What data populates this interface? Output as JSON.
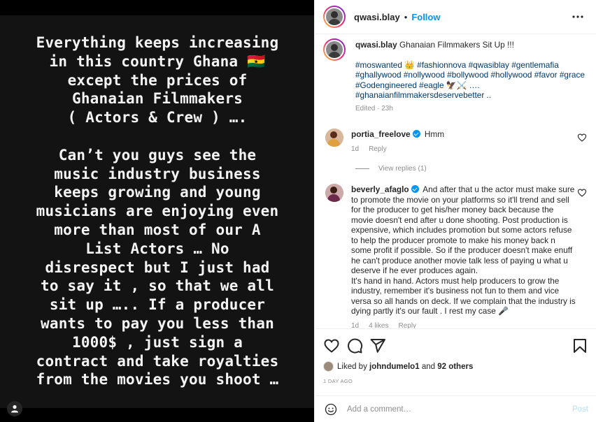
{
  "media": {
    "story_paragraphs": [
      "Everything keeps increasing\nin this country Ghana 🇬🇭\nexcept the prices of\nGhanaian Filmmakers\n( Actors & Crew ) ….",
      "Can’t you guys see the\nmusic industry business\nkeeps growing and young\nmusicians are enjoying even\nmore than most of our A\nList Actors …  No\ndisrespect but I just had\nto say it , so that we all\nsit up ….. If a producer\nwants to pay you less than\n1000$ , just sign a\ncontract and take royalties\nfrom the movies you shoot …"
    ],
    "tag_icon": "user-icon"
  },
  "header": {
    "username": "qwasi.blay",
    "separator": "•",
    "follow_label": "Follow",
    "more_icon": "more-horizontal-icon"
  },
  "caption": {
    "username": "qwasi.blay",
    "text": "Ghanaian Filmmakers Sit Up !!!",
    "hashtags": "#moswanted 👑 #fashionnova #qwasiblay #gentlemafia #ghallywood #nollywood #bollywood #hollywood #favor #grace #Godengineered #eagle 🦅⚔️ …. #ghanaianfilmmakersdeservebetter ..",
    "edited": "Edited · 23h"
  },
  "comments": [
    {
      "username": "portia_freelove",
      "verified": true,
      "text": "Hmm",
      "time": "1d",
      "reply_label": "Reply",
      "view_replies": "View replies (1)"
    },
    {
      "username": "beverly_afaglo",
      "verified": true,
      "text": "And after that u the actor must make sure to promote the movie on your platforms so it'll trend and sell for the producer to get his/her money back because the movie doesn't end after u done shooting. Post production is expensive, which includes promotion but some actors refuse to help the producer promote to make his money back n some profit if possible. So if the producer doesn't make enuff he can't produce another movie talk less of paying u what u deserve if he ever produces again.",
      "text2": "It's hand in hand. Actors must help producers to grow the industry, remember it's business not fun to them and vice versa so all hands on deck. If we complain that the industry is dying partly it's our fault . I rest my case 🎤",
      "time": "1d",
      "likes": "4 likes",
      "reply_label": "Reply"
    }
  ],
  "actions": {
    "like_icon": "heart-icon",
    "comment_icon": "comment-icon",
    "share_icon": "share-icon",
    "save_icon": "bookmark-icon",
    "liked_by_prefix": "Liked by",
    "liked_by_user": "johndumelo1",
    "liked_by_and": "and",
    "liked_by_others": "92 others",
    "date": "1 DAY AGO"
  },
  "add_comment": {
    "emoji_icon": "smiley-icon",
    "placeholder": "Add a comment…",
    "post_label": "Post"
  },
  "colors": {
    "accent": "#0095f6",
    "hashtag": "#00376b",
    "muted": "#8e8e8e"
  }
}
